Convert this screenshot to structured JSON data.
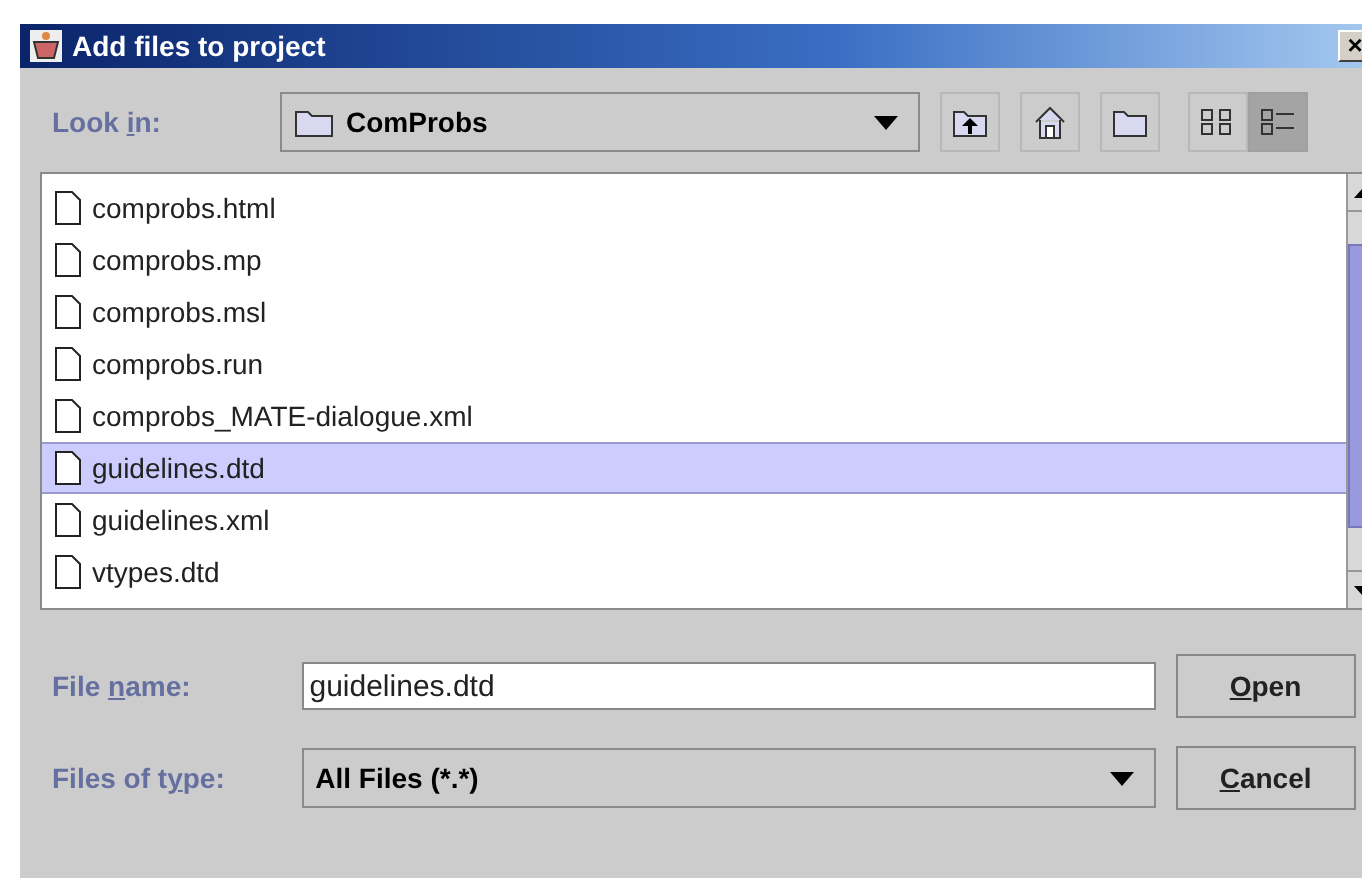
{
  "window": {
    "title": "Add files to project",
    "close": "×"
  },
  "look_in": {
    "label": [
      {
        "text": "Look "
      },
      {
        "text": "i",
        "underline": true
      },
      {
        "text": "n:"
      }
    ],
    "value": "ComProbs"
  },
  "toolbar": [
    {
      "kind": "up"
    },
    {
      "kind": "home"
    },
    {
      "kind": "newfolder"
    },
    {
      "kind": "list",
      "selected": false
    },
    {
      "kind": "details",
      "selected": true
    }
  ],
  "files": [
    {
      "name": "comprobs.html",
      "selected": false
    },
    {
      "name": "comprobs.mp",
      "selected": false
    },
    {
      "name": "comprobs.msl",
      "selected": false
    },
    {
      "name": "comprobs.run",
      "selected": false
    },
    {
      "name": "comprobs_MATE-dialogue.xml",
      "selected": false
    },
    {
      "name": "guidelines.dtd",
      "selected": true
    },
    {
      "name": "guidelines.xml",
      "selected": false
    },
    {
      "name": "vtypes.dtd",
      "selected": false
    }
  ],
  "file_name": {
    "label": [
      {
        "text": "File "
      },
      {
        "text": "n",
        "underline": true
      },
      {
        "text": "ame:"
      }
    ],
    "value": "guidelines.dtd"
  },
  "file_type": {
    "label": [
      {
        "text": "Files of t"
      },
      {
        "text": "y",
        "underline": true
      },
      {
        "text": "pe:"
      }
    ],
    "value": "All Files (*.*)"
  },
  "buttons": [
    {
      "label": [
        {
          "text": "O",
          "underline": true
        },
        {
          "text": "pen"
        }
      ]
    },
    {
      "label": [
        {
          "text": "C",
          "underline": true
        },
        {
          "text": "ancel"
        }
      ]
    }
  ]
}
